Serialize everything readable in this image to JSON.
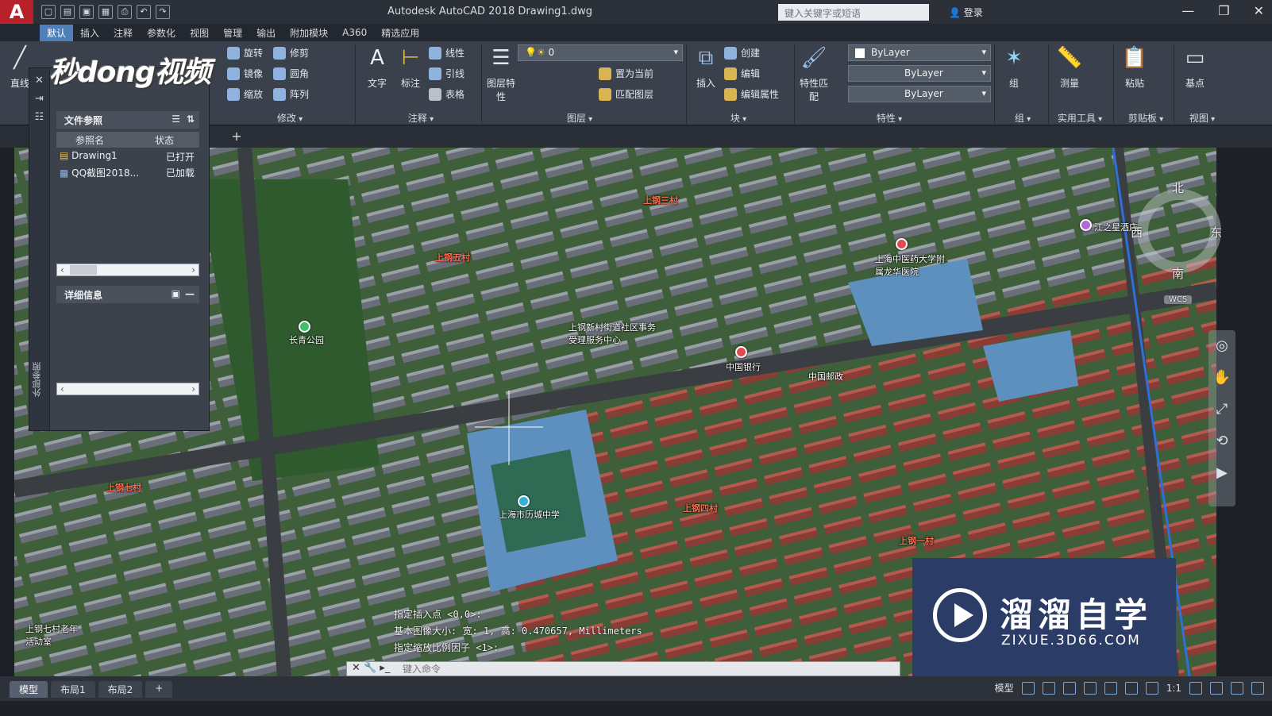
{
  "window": {
    "title": "Autodesk AutoCAD 2018    Drawing1.dwg",
    "app_logo": "A",
    "search_placeholder": "键入关键字或短语",
    "login_label": "登录",
    "minimize": "—",
    "restore": "❐",
    "close": "✕"
  },
  "ribbon_tabs": [
    "默认",
    "插入",
    "注释",
    "参数化",
    "视图",
    "管理",
    "输出",
    "附加模块",
    "A360",
    "精选应用"
  ],
  "ribbon": {
    "draw": {
      "line": "直线"
    },
    "modify": {
      "label": "修改",
      "rotate": "旋转",
      "trim": "修剪",
      "mirror": "镜像",
      "fillet": "圆角",
      "scale": "缩放",
      "array": "阵列"
    },
    "annotation": {
      "label": "注释",
      "text": "文字",
      "dimension": "标注",
      "linear": "线性",
      "leader": "引线",
      "table": "表格"
    },
    "layers": {
      "label": "图层",
      "layer_properties": "图层特性",
      "layer_value": "0",
      "set_current": "置为当前",
      "match_layer": "匹配图层"
    },
    "block": {
      "label": "块",
      "insert": "插入",
      "create": "创建",
      "edit": "编辑",
      "edit_attributes": "编辑属性"
    },
    "properties": {
      "label": "特性",
      "match_properties": "特性匹配",
      "color": "ByLayer",
      "linetype": "ByLayer",
      "lineweight": "ByLayer"
    },
    "groups": {
      "label": "组",
      "group": "组"
    },
    "utilities": {
      "label": "实用工具",
      "measure": "测量"
    },
    "clipboard": {
      "label": "剪贴板",
      "paste": "粘贴"
    },
    "view": {
      "label": "视图",
      "base": "基点"
    }
  },
  "xref_panel": {
    "file_refs_title": "文件参照",
    "col_name": "参照名",
    "col_status": "状态",
    "rows": [
      {
        "name": "Drawing1",
        "status": "已打开"
      },
      {
        "name": "QQ截图2018...",
        "status": "已加载"
      }
    ],
    "details_title": "详细信息",
    "side_title": "外部参照"
  },
  "overlay_logo": "秒dong视频",
  "viewcube": {
    "north": "北",
    "south": "南",
    "east": "东",
    "west": "西",
    "wcs": "WCS"
  },
  "map_labels": [
    {
      "text": "上钢三村",
      "red": true
    },
    {
      "text": "上钢五村",
      "red": true
    },
    {
      "text": "上钢七村",
      "red": true
    },
    {
      "text": "上钢四村",
      "red": true
    },
    {
      "text": "上钢一村",
      "red": true
    },
    {
      "text": "长青公园",
      "red": false
    },
    {
      "text": "中国银行",
      "red": false
    },
    {
      "text": "上海市历城中学",
      "red": false
    },
    {
      "text": "上海中医药大学附属龙华医院",
      "red": false
    },
    {
      "text": "上钢新村街道社区事务受理服务中心",
      "red": false
    },
    {
      "text": "上钢七村老年活动室",
      "red": false
    },
    {
      "text": "江之星酒店",
      "red": false
    },
    {
      "text": "中国邮政",
      "red": false
    }
  ],
  "command_log": [
    "指定插入点 <0,0>:",
    "基本图像大小: 宽: 1, 高: 0.470657, Millimeters",
    "指定缩放比例因子 <1>:"
  ],
  "command_placeholder": "键入命令",
  "watermark": {
    "title": "溜溜自学",
    "url": "ZIXUE.3D66.COM"
  },
  "status": {
    "layout_tabs": [
      "模型",
      "布局1",
      "布局2",
      "+"
    ],
    "model_label": "模型",
    "scale": "1:1"
  },
  "colors": {
    "accent": "#4e7fb8",
    "app_red": "#b8202a",
    "ribbon_bg": "#3a414c",
    "label_red": "#ff6a4a"
  }
}
